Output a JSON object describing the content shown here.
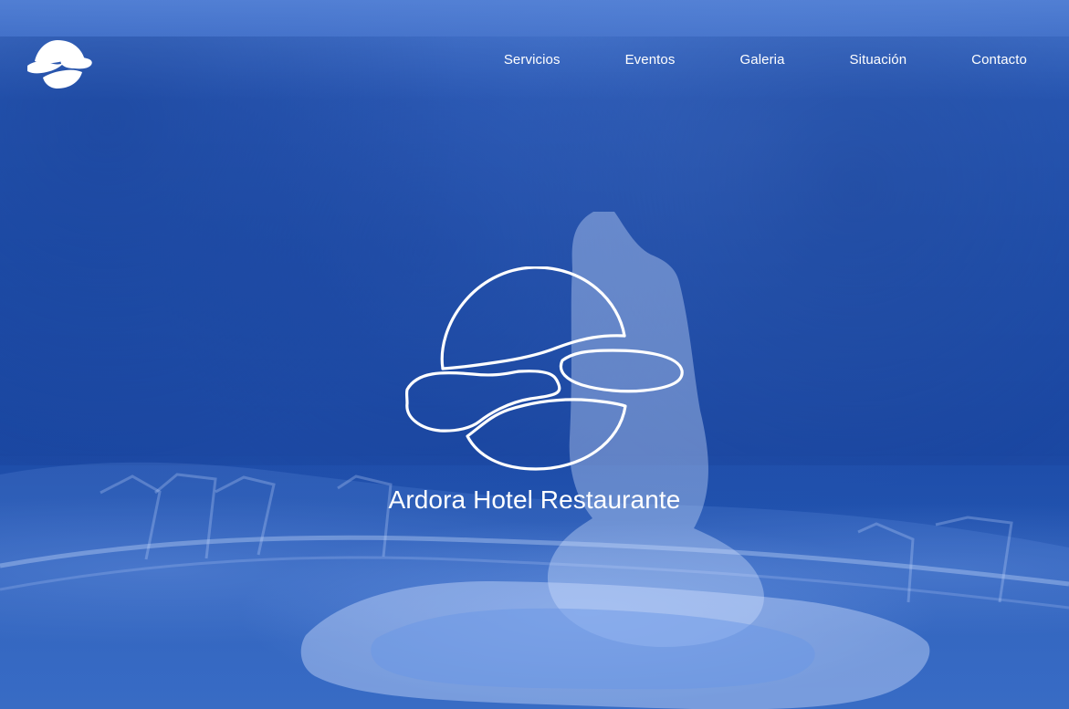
{
  "site": {
    "title": "Ardora Hotel Restaurante"
  },
  "nav": {
    "items": [
      {
        "label": "Servicios"
      },
      {
        "label": "Eventos"
      },
      {
        "label": "Galeria"
      },
      {
        "label": "Situación"
      },
      {
        "label": "Contacto"
      }
    ]
  },
  "theme": {
    "overlay_blue": "#1f4fb0",
    "text": "#ffffff"
  },
  "icons": {
    "brand_logo": "logo-icon",
    "hero_logo": "hero-logo-icon"
  }
}
